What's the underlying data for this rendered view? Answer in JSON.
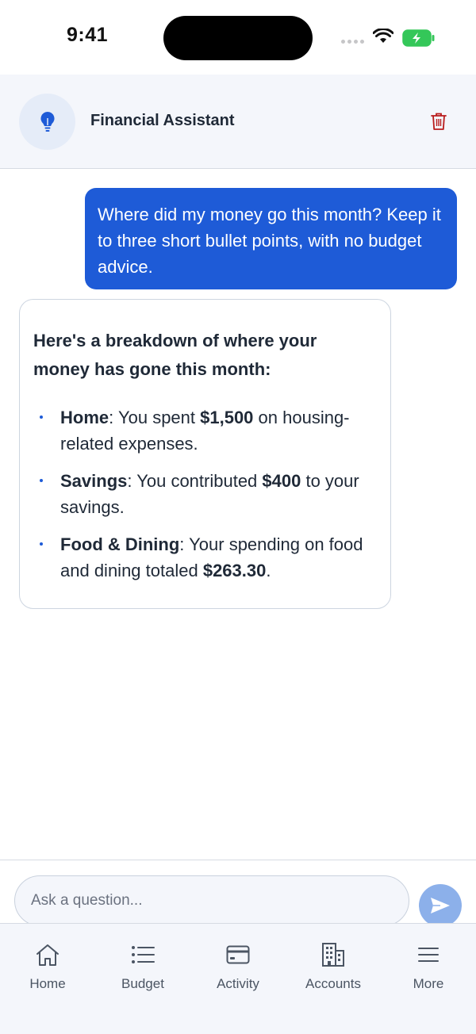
{
  "status_bar": {
    "time": "9:41"
  },
  "header": {
    "title": "Financial Assistant",
    "avatar_icon": "lightbulb-icon",
    "delete_icon": "trash-icon"
  },
  "conversation": {
    "user_message": "Where did my money go this month? Keep it to three short bullet points, with no budget advice.",
    "assistant": {
      "heading": "Here's a breakdown of where your money has gone this month:",
      "bullets": [
        {
          "label": "Home",
          "pre": ": You spent ",
          "amount": "$1,500",
          "post": " on housing-related expenses."
        },
        {
          "label": "Savings",
          "pre": ": You contributed ",
          "amount": "$400",
          "post": " to your savings."
        },
        {
          "label": "Food & Dining",
          "pre": ": Your spending on food and dining totaled ",
          "amount": "$263.30",
          "post": "."
        }
      ]
    }
  },
  "composer": {
    "placeholder": "Ask a question...",
    "value": "",
    "send_icon": "send-icon"
  },
  "tabs": [
    {
      "label": "Home",
      "icon": "home-icon"
    },
    {
      "label": "Budget",
      "icon": "list-icon"
    },
    {
      "label": "Activity",
      "icon": "card-icon"
    },
    {
      "label": "Accounts",
      "icon": "building-icon"
    },
    {
      "label": "More",
      "icon": "menu-icon"
    }
  ],
  "colors": {
    "accent": "#1e5bd7",
    "send_button": "#8cb0ea",
    "delete": "#b91c1c",
    "header_bg": "#f4f6fb"
  }
}
